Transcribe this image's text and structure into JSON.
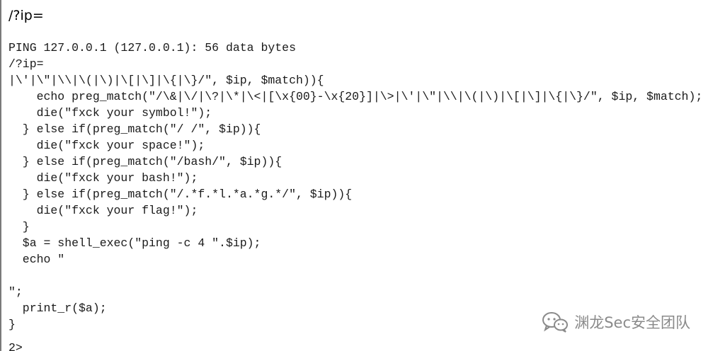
{
  "heading": "/?ip=",
  "output_lines": [
    "PING 127.0.0.1 (127.0.0.1): 56 data bytes",
    "/?ip=",
    "|\\'|\\\"|\\\\|\\(|\\)|\\[|\\]|\\{|\\}/\", $ip, $match)){",
    "    echo preg_match(\"/\\&|\\/|\\?|\\*|\\<|[\\x{00}-\\x{20}]|\\>|\\'|\\\"|\\\\|\\(|\\)|\\[|\\]|\\{|\\}/\", $ip, $match);",
    "    die(\"fxck your symbol!\");",
    "  } else if(preg_match(\"/ /\", $ip)){",
    "    die(\"fxck your space!\");",
    "  } else if(preg_match(\"/bash/\", $ip)){",
    "    die(\"fxck your bash!\");",
    "  } else if(preg_match(\"/.*f.*l.*a.*g.*/\", $ip)){",
    "    die(\"fxck your flag!\");",
    "  }",
    "  $a = shell_exec(\"ping -c 4 \".$ip);",
    "  echo \"",
    "",
    "\";",
    "  print_r($a);",
    "}"
  ],
  "cut_off_line": "2>",
  "watermark": {
    "icon": "wechat-icon",
    "text": "渊龙Sec安全团队"
  }
}
